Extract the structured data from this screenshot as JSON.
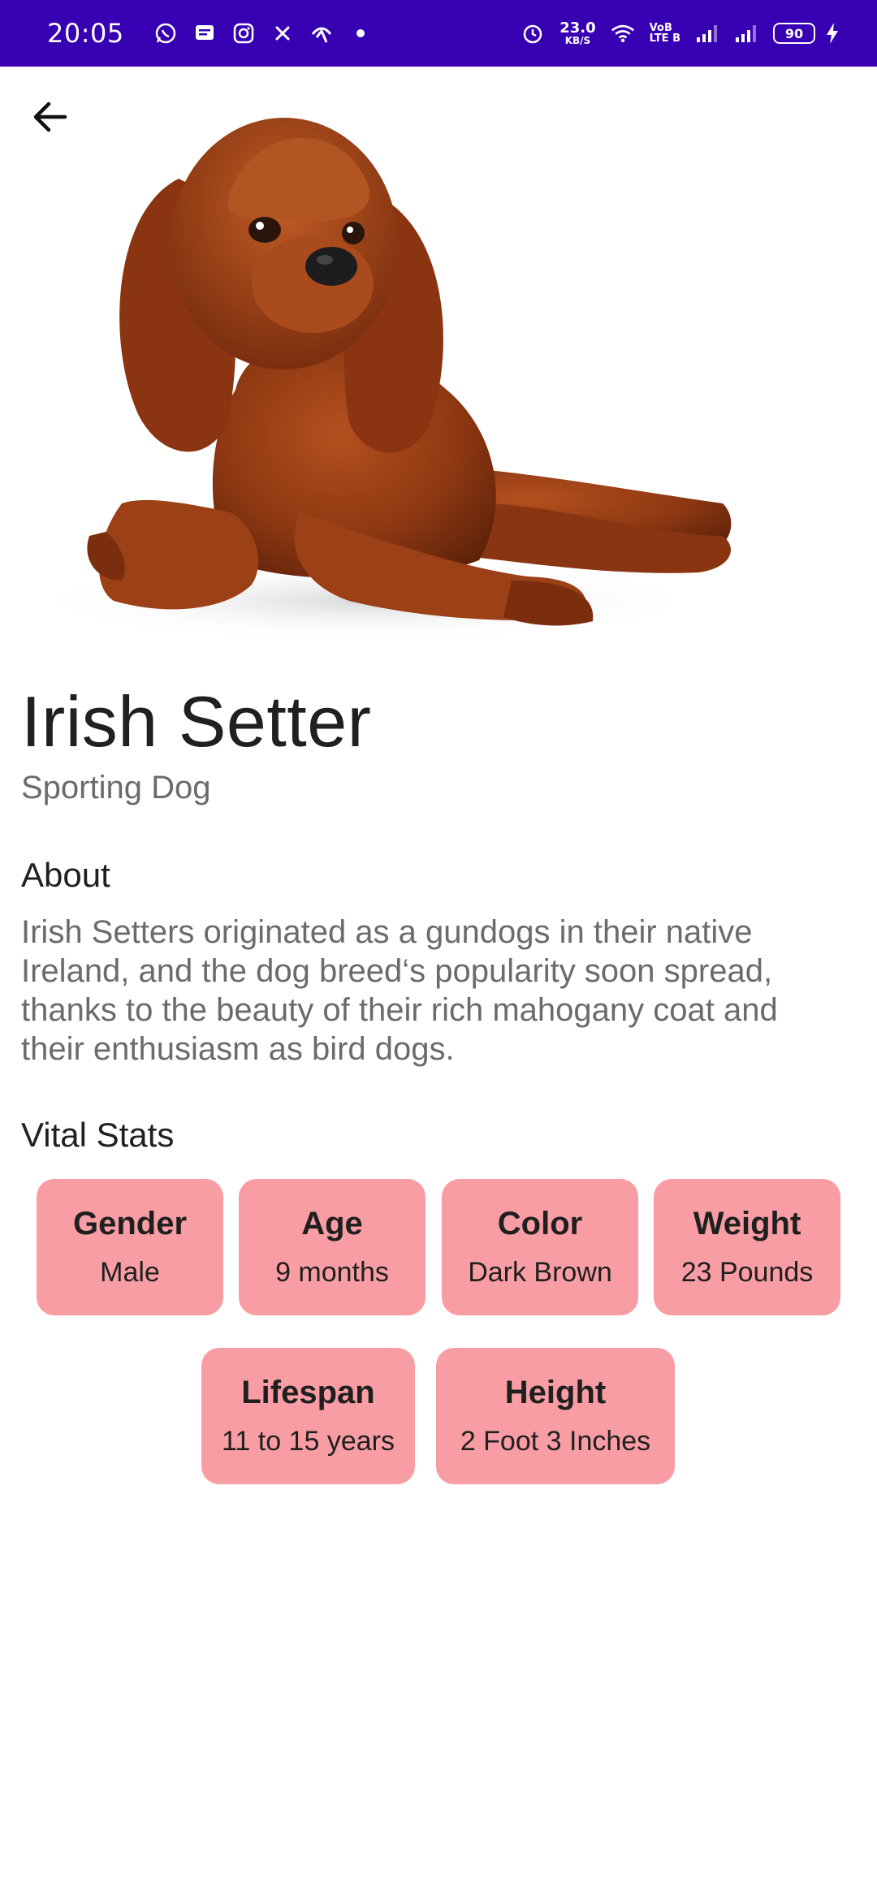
{
  "status_bar": {
    "time": "20:05",
    "net_speed_value": "23.0",
    "net_speed_unit": "KB/S",
    "volte_top": "VoB",
    "volte_bottom": "LTE B",
    "battery": "90"
  },
  "icons": {
    "back": "arrow-back-icon",
    "whatsapp": "whatsapp-icon",
    "message": "message-icon",
    "instagram": "instagram-icon",
    "fan": "fan-icon",
    "hotspot": "hotspot-icon",
    "alarm": "alarm-icon",
    "wifi": "wifi-icon",
    "signal": "signal-icon",
    "charging": "charging-icon"
  },
  "colors": {
    "status_bar": "#3700b3",
    "card": "#f99da4"
  },
  "breed": {
    "name": "Irish Setter",
    "group": "Sporting Dog"
  },
  "about": {
    "heading": "About",
    "text": "Irish Setters originated as a gundogs in their native Ireland, and the dog breed‘s popularity soon spread, thanks to the beauty of their rich mahogany coat and their enthusiasm as bird dogs."
  },
  "vital_stats": {
    "heading": "Vital Stats",
    "items": [
      {
        "label": "Gender",
        "value": "Male"
      },
      {
        "label": "Age",
        "value": "9 months"
      },
      {
        "label": "Color",
        "value": "Dark Brown"
      },
      {
        "label": "Weight",
        "value": "23 Pounds"
      },
      {
        "label": "Lifespan",
        "value": "11 to 15 years"
      },
      {
        "label": "Height",
        "value": "2 Foot 3 Inches"
      }
    ]
  }
}
